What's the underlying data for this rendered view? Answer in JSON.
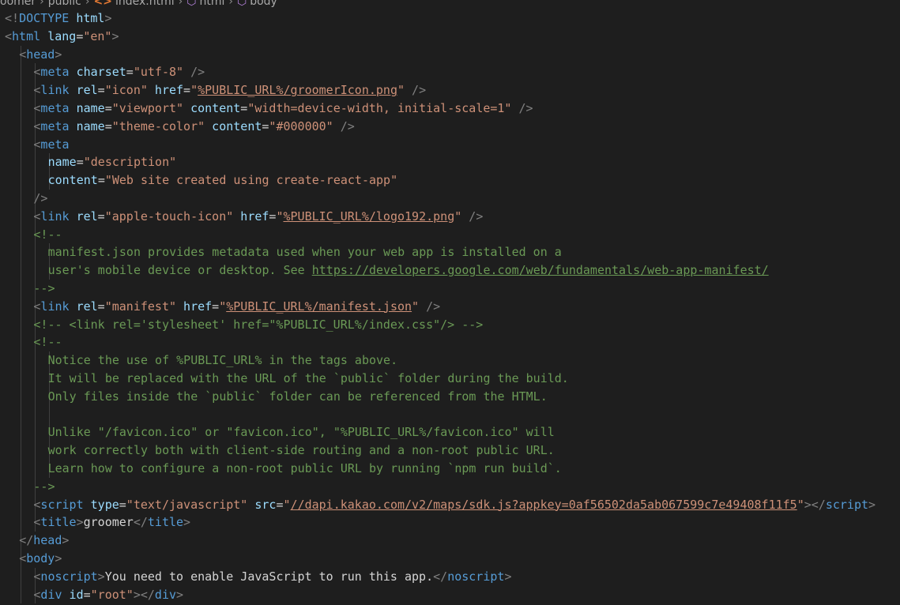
{
  "breadcrumb": [
    {
      "label": "oomer",
      "icon": ""
    },
    {
      "label": "public",
      "icon": ""
    },
    {
      "label": "index.html",
      "icon": "html-file-icon"
    },
    {
      "label": "html",
      "icon": "element-icon"
    },
    {
      "label": "body",
      "icon": "element-icon"
    }
  ],
  "colors": {
    "background": "#1e1e1e",
    "tag": "#569cd6",
    "bracket": "#808080",
    "attribute": "#9cdcfe",
    "string": "#ce9178",
    "comment": "#6a9955",
    "text": "#d4d4d4"
  },
  "lines": [
    {
      "indent": 0,
      "tokens": [
        [
          "br",
          "<!"
        ],
        [
          "kw",
          "DOCTYPE"
        ],
        [
          "txt",
          " "
        ],
        [
          "attr",
          "html"
        ],
        [
          "br",
          ">"
        ]
      ]
    },
    {
      "indent": 0,
      "tokens": [
        [
          "br",
          "<"
        ],
        [
          "tag",
          "html"
        ],
        [
          "txt",
          " "
        ],
        [
          "attr",
          "lang"
        ],
        [
          "eq",
          "="
        ],
        [
          "str",
          "\"en\""
        ],
        [
          "br",
          ">"
        ]
      ]
    },
    {
      "indent": 1,
      "tokens": [
        [
          "br",
          "<"
        ],
        [
          "tag",
          "head"
        ],
        [
          "br",
          ">"
        ]
      ]
    },
    {
      "indent": 2,
      "tokens": [
        [
          "br",
          "<"
        ],
        [
          "tag",
          "meta"
        ],
        [
          "txt",
          " "
        ],
        [
          "attr",
          "charset"
        ],
        [
          "eq",
          "="
        ],
        [
          "str",
          "\"utf-8\""
        ],
        [
          "txt",
          " "
        ],
        [
          "br",
          "/>"
        ]
      ]
    },
    {
      "indent": 2,
      "tokens": [
        [
          "br",
          "<"
        ],
        [
          "tag",
          "link"
        ],
        [
          "txt",
          " "
        ],
        [
          "attr",
          "rel"
        ],
        [
          "eq",
          "="
        ],
        [
          "str",
          "\"icon\""
        ],
        [
          "txt",
          " "
        ],
        [
          "attr",
          "href"
        ],
        [
          "eq",
          "="
        ],
        [
          "str",
          "\""
        ],
        [
          "strul",
          "%PUBLIC_URL%/groomerIcon.png"
        ],
        [
          "str",
          "\""
        ],
        [
          "txt",
          " "
        ],
        [
          "br",
          "/>"
        ]
      ]
    },
    {
      "indent": 2,
      "tokens": [
        [
          "br",
          "<"
        ],
        [
          "tag",
          "meta"
        ],
        [
          "txt",
          " "
        ],
        [
          "attr",
          "name"
        ],
        [
          "eq",
          "="
        ],
        [
          "str",
          "\"viewport\""
        ],
        [
          "txt",
          " "
        ],
        [
          "attr",
          "content"
        ],
        [
          "eq",
          "="
        ],
        [
          "str",
          "\"width=device-width, initial-scale=1\""
        ],
        [
          "txt",
          " "
        ],
        [
          "br",
          "/>"
        ]
      ]
    },
    {
      "indent": 2,
      "tokens": [
        [
          "br",
          "<"
        ],
        [
          "tag",
          "meta"
        ],
        [
          "txt",
          " "
        ],
        [
          "attr",
          "name"
        ],
        [
          "eq",
          "="
        ],
        [
          "str",
          "\"theme-color\""
        ],
        [
          "txt",
          " "
        ],
        [
          "attr",
          "content"
        ],
        [
          "eq",
          "="
        ],
        [
          "str",
          "\"#000000\""
        ],
        [
          "txt",
          " "
        ],
        [
          "br",
          "/>"
        ]
      ]
    },
    {
      "indent": 2,
      "tokens": [
        [
          "br",
          "<"
        ],
        [
          "tag",
          "meta"
        ]
      ]
    },
    {
      "indent": 3,
      "tokens": [
        [
          "attr",
          "name"
        ],
        [
          "eq",
          "="
        ],
        [
          "str",
          "\"description\""
        ]
      ]
    },
    {
      "indent": 3,
      "tokens": [
        [
          "attr",
          "content"
        ],
        [
          "eq",
          "="
        ],
        [
          "str",
          "\"Web site created using create-react-app\""
        ]
      ]
    },
    {
      "indent": 2,
      "tokens": [
        [
          "br",
          "/>"
        ]
      ]
    },
    {
      "indent": 2,
      "tokens": [
        [
          "br",
          "<"
        ],
        [
          "tag",
          "link"
        ],
        [
          "txt",
          " "
        ],
        [
          "attr",
          "rel"
        ],
        [
          "eq",
          "="
        ],
        [
          "str",
          "\"apple-touch-icon\""
        ],
        [
          "txt",
          " "
        ],
        [
          "attr",
          "href"
        ],
        [
          "eq",
          "="
        ],
        [
          "str",
          "\""
        ],
        [
          "strul",
          "%PUBLIC_URL%/logo192.png"
        ],
        [
          "str",
          "\""
        ],
        [
          "txt",
          " "
        ],
        [
          "br",
          "/>"
        ]
      ]
    },
    {
      "indent": 2,
      "tokens": [
        [
          "cmt",
          "<!--"
        ]
      ]
    },
    {
      "indent": 3,
      "tokens": [
        [
          "cmt",
          "manifest.json provides metadata used when your web app is installed on a"
        ]
      ]
    },
    {
      "indent": 3,
      "tokens": [
        [
          "cmt",
          "user's mobile device or desktop. See "
        ],
        [
          "cmtul",
          "https://developers.google.com/web/fundamentals/web-app-manifest/"
        ]
      ]
    },
    {
      "indent": 2,
      "tokens": [
        [
          "cmt",
          "-->"
        ]
      ]
    },
    {
      "indent": 2,
      "tokens": [
        [
          "br",
          "<"
        ],
        [
          "tag",
          "link"
        ],
        [
          "txt",
          " "
        ],
        [
          "attr",
          "rel"
        ],
        [
          "eq",
          "="
        ],
        [
          "str",
          "\"manifest\""
        ],
        [
          "txt",
          " "
        ],
        [
          "attr",
          "href"
        ],
        [
          "eq",
          "="
        ],
        [
          "str",
          "\""
        ],
        [
          "strul",
          "%PUBLIC_URL%/manifest.json"
        ],
        [
          "str",
          "\""
        ],
        [
          "txt",
          " "
        ],
        [
          "br",
          "/>"
        ]
      ]
    },
    {
      "indent": 2,
      "tokens": [
        [
          "cmt",
          "<!-- <link rel='stylesheet' href=\"%PUBLIC_URL%/index.css\"/> -->"
        ]
      ]
    },
    {
      "indent": 2,
      "tokens": [
        [
          "cmt",
          "<!--"
        ]
      ]
    },
    {
      "indent": 3,
      "tokens": [
        [
          "cmt",
          "Notice the use of %PUBLIC_URL% in the tags above."
        ]
      ]
    },
    {
      "indent": 3,
      "tokens": [
        [
          "cmt",
          "It will be replaced with the URL of the `public` folder during the build."
        ]
      ]
    },
    {
      "indent": 3,
      "tokens": [
        [
          "cmt",
          "Only files inside the `public` folder can be referenced from the HTML."
        ]
      ]
    },
    {
      "indent": 3,
      "tokens": []
    },
    {
      "indent": 3,
      "tokens": [
        [
          "cmt",
          "Unlike \"/favicon.ico\" or \"favicon.ico\", \"%PUBLIC_URL%/favicon.ico\" will"
        ]
      ]
    },
    {
      "indent": 3,
      "tokens": [
        [
          "cmt",
          "work correctly both with client-side routing and a non-root public URL."
        ]
      ]
    },
    {
      "indent": 3,
      "tokens": [
        [
          "cmt",
          "Learn how to configure a non-root public URL by running `npm run build`."
        ]
      ]
    },
    {
      "indent": 2,
      "tokens": [
        [
          "cmt",
          "-->"
        ]
      ]
    },
    {
      "indent": 2,
      "tokens": [
        [
          "br",
          "<"
        ],
        [
          "tag",
          "script"
        ],
        [
          "txt",
          " "
        ],
        [
          "attr",
          "type"
        ],
        [
          "eq",
          "="
        ],
        [
          "str",
          "\"text/javascript\""
        ],
        [
          "txt",
          " "
        ],
        [
          "attr",
          "src"
        ],
        [
          "eq",
          "="
        ],
        [
          "str",
          "\""
        ],
        [
          "strul",
          "//dapi.kakao.com/v2/maps/sdk.js?appkey=0af56502da5ab067599c7e49408f11f5"
        ],
        [
          "str",
          "\""
        ],
        [
          "br",
          "></"
        ],
        [
          "tag",
          "script"
        ],
        [
          "br",
          ">"
        ]
      ]
    },
    {
      "indent": 2,
      "tokens": [
        [
          "br",
          "<"
        ],
        [
          "tag",
          "title"
        ],
        [
          "br",
          ">"
        ],
        [
          "txt",
          "groomer"
        ],
        [
          "br",
          "</"
        ],
        [
          "tag",
          "title"
        ],
        [
          "br",
          ">"
        ]
      ]
    },
    {
      "indent": 1,
      "tokens": [
        [
          "br",
          "</"
        ],
        [
          "tag",
          "head"
        ],
        [
          "br",
          ">"
        ]
      ]
    },
    {
      "indent": 1,
      "tokens": [
        [
          "br",
          "<"
        ],
        [
          "tag",
          "body"
        ],
        [
          "br",
          ">"
        ]
      ]
    },
    {
      "indent": 2,
      "tokens": [
        [
          "br",
          "<"
        ],
        [
          "tag",
          "noscript"
        ],
        [
          "br",
          ">"
        ],
        [
          "txt",
          "You need to enable JavaScript to run this app."
        ],
        [
          "br",
          "</"
        ],
        [
          "tag",
          "noscript"
        ],
        [
          "br",
          ">"
        ]
      ]
    },
    {
      "indent": 2,
      "tokens": [
        [
          "br",
          "<"
        ],
        [
          "tag",
          "div"
        ],
        [
          "txt",
          " "
        ],
        [
          "attr",
          "id"
        ],
        [
          "eq",
          "="
        ],
        [
          "str",
          "\"root\""
        ],
        [
          "br",
          "></"
        ],
        [
          "tag",
          "div"
        ],
        [
          "br",
          ">"
        ]
      ]
    }
  ]
}
